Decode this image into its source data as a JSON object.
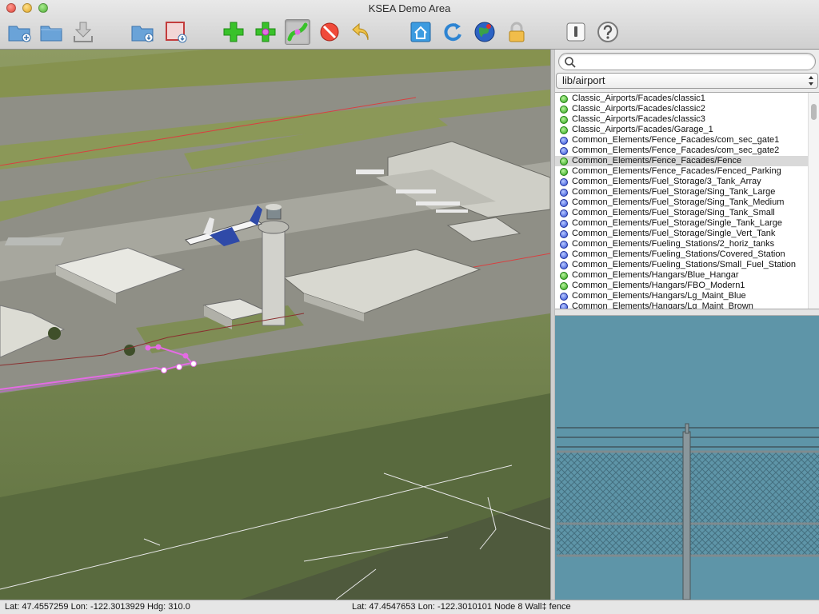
{
  "window": {
    "title": "KSEA Demo Area"
  },
  "toolbar": {
    "buttons": [
      {
        "name": "new-folder-button",
        "icon": "folder-plus-icon"
      },
      {
        "name": "open-folder-button",
        "icon": "folder-icon"
      },
      {
        "name": "save-button",
        "icon": "download-tray-icon"
      },
      {
        "name": "import-button",
        "icon": "folder-import-icon"
      },
      {
        "name": "export-button",
        "icon": "box-export-icon"
      },
      {
        "name": "add-item-button",
        "icon": "green-plus-icon"
      },
      {
        "name": "add-node-button",
        "icon": "plus-node-icon"
      },
      {
        "name": "bezier-tool-button",
        "icon": "curve-tool-icon"
      },
      {
        "name": "delete-button",
        "icon": "no-entry-icon"
      },
      {
        "name": "undo-button",
        "icon": "undo-arrow-icon"
      },
      {
        "name": "home-view-button",
        "icon": "house-icon"
      },
      {
        "name": "rotate-button",
        "icon": "rotate-icon"
      },
      {
        "name": "globe-button",
        "icon": "globe-icon"
      },
      {
        "name": "lock-button",
        "icon": "padlock-icon"
      },
      {
        "name": "inspector-button",
        "icon": "switch-icon"
      },
      {
        "name": "help-button",
        "icon": "question-icon"
      }
    ]
  },
  "library": {
    "search_value": "",
    "path_selected": "lib/airport",
    "selected_index": 6,
    "items": [
      {
        "label": "Classic_Airports/Facades/classic1",
        "kind": "green"
      },
      {
        "label": "Classic_Airports/Facades/classic2",
        "kind": "green"
      },
      {
        "label": "Classic_Airports/Facades/classic3",
        "kind": "green"
      },
      {
        "label": "Classic_Airports/Facades/Garage_1",
        "kind": "green"
      },
      {
        "label": "Common_Elements/Fence_Facades/com_sec_gate1",
        "kind": "blue"
      },
      {
        "label": "Common_Elements/Fence_Facades/com_sec_gate2",
        "kind": "blue"
      },
      {
        "label": "Common_Elements/Fence_Facades/Fence",
        "kind": "green"
      },
      {
        "label": "Common_Elements/Fence_Facades/Fenced_Parking",
        "kind": "green"
      },
      {
        "label": "Common_Elements/Fuel_Storage/3_Tank_Array",
        "kind": "blue"
      },
      {
        "label": "Common_Elements/Fuel_Storage/Sing_Tank_Large",
        "kind": "blue"
      },
      {
        "label": "Common_Elements/Fuel_Storage/Sing_Tank_Medium",
        "kind": "blue"
      },
      {
        "label": "Common_Elements/Fuel_Storage/Sing_Tank_Small",
        "kind": "blue"
      },
      {
        "label": "Common_Elements/Fuel_Storage/Single_Tank_Large",
        "kind": "blue"
      },
      {
        "label": "Common_Elements/Fuel_Storage/Single_Vert_Tank",
        "kind": "blue"
      },
      {
        "label": "Common_Elements/Fueling_Stations/2_horiz_tanks",
        "kind": "blue"
      },
      {
        "label": "Common_Elements/Fueling_Stations/Covered_Station",
        "kind": "blue"
      },
      {
        "label": "Common_Elements/Fueling_Stations/Small_Fuel_Station",
        "kind": "blue"
      },
      {
        "label": "Common_Elements/Hangars/Blue_Hangar",
        "kind": "green"
      },
      {
        "label": "Common_Elements/Hangars/FBO_Modern1",
        "kind": "green"
      },
      {
        "label": "Common_Elements/Hangars/Lg_Maint_Blue",
        "kind": "blue"
      },
      {
        "label": "Common_Elements/Hangars/Lg_Maint_Brown",
        "kind": "blue"
      }
    ]
  },
  "status": {
    "cursor": "Lat: 47.4557259  Lon: -122.3013929  Hdg: 310.0",
    "node": "Lat: 47.4547653  Lon: -122.3010101  Node 8  Wall‡ fence"
  },
  "colors": {
    "accent_green": "#2fa51a",
    "accent_blue": "#3050d8",
    "selected_row": "#d9d9d9",
    "fence_line": "#e46be4",
    "runway_marking": "#d84040"
  }
}
